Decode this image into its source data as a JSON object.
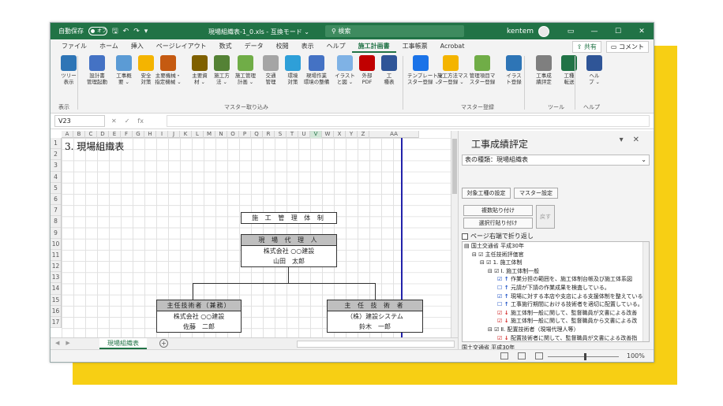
{
  "titlebar": {
    "autosave_label": "自動保存",
    "autosave_state": "オフ",
    "doc_title": "現場組織表-1_0.xls - 互換モード ⌄",
    "search_placeholder": "検索",
    "user": "kentem",
    "minimize": "—",
    "maximize": "☐",
    "close": "✕"
  },
  "menu": {
    "items": [
      "ファイル",
      "ホーム",
      "挿入",
      "ページレイアウト",
      "数式",
      "データ",
      "校閲",
      "表示",
      "ヘルプ",
      "施工計画書",
      "工事帳票",
      "Acrobat"
    ],
    "active": "施工計画書",
    "share": "共有",
    "comment": "コメント"
  },
  "ribbon": {
    "buttons": [
      {
        "label": "ツリー\n表示",
        "color": "#2e75b6"
      },
      {
        "label": "設計書\n管理起動",
        "color": "#4472c4"
      },
      {
        "label": "工事概\n要 ⌄",
        "color": "#5b9bd5"
      },
      {
        "label": "安全\n対策",
        "color": "#f4b400"
      },
      {
        "label": "主要機械・\n指定機械 ⌄",
        "color": "#c55a11"
      },
      {
        "label": "主要資\n材 ⌄",
        "color": "#7f6000"
      },
      {
        "label": "施工方\n法 ⌄",
        "color": "#548235"
      },
      {
        "label": "施工管理\n計画 ⌄",
        "color": "#70ad47"
      },
      {
        "label": "交通\n管理",
        "color": "#a5a5a5"
      },
      {
        "label": "環境\n対策",
        "color": "#2e9fd8"
      },
      {
        "label": "現場作業\n環境の整備",
        "color": "#4472c4"
      },
      {
        "label": "イラスト\nと図 ⌄",
        "color": "#7fb2e5"
      },
      {
        "label": "外部\nPDF",
        "color": "#c00000"
      },
      {
        "label": "工\n種表",
        "color": "#2f5597"
      },
      {
        "label": "テンプレートマ\nスター登録 ⌄",
        "color": "#1a73e8"
      },
      {
        "label": "施工方法マス\nター登録 ⌄",
        "color": "#f4b400"
      },
      {
        "label": "管理項目マ\nスター登録",
        "color": "#70ad47"
      },
      {
        "label": "イラス\nト登録",
        "color": "#2e75b6"
      },
      {
        "label": "工事成\n績評定",
        "color": "#7f7f7f"
      },
      {
        "label": "工種\n転送",
        "color": "#217346"
      },
      {
        "label": "ヘル\nプ ⌄",
        "color": "#2f5597"
      }
    ],
    "groups": [
      "表示",
      "マスター取り込み",
      "マスター登録",
      "ツール",
      "ヘルプ"
    ]
  },
  "formula": {
    "cell": "V23",
    "cancel": "✕",
    "enter": "✓",
    "fx": "fx"
  },
  "sheet": {
    "columns": [
      "A",
      "B",
      "C",
      "D",
      "E",
      "F",
      "G",
      "H",
      "I",
      "J",
      "K",
      "L",
      "M",
      "N",
      "O",
      "P",
      "Q",
      "R",
      "S",
      "T",
      "U",
      "V",
      "W",
      "X",
      "Y",
      "Z",
      "AA"
    ],
    "selected_column": "V",
    "rows": [
      "1",
      "2",
      "3",
      "4",
      "5",
      "6",
      "7",
      "8",
      "9",
      "10",
      "11",
      "12",
      "13",
      "14",
      "15",
      "16",
      "17"
    ],
    "title": "3. 現場組織表",
    "system_title": "施 工 管 理 体 制",
    "agent": {
      "role": "現 場 代 理 人",
      "company": "株式会社 ○○建設",
      "name": "山田　太郎"
    },
    "engineer_left": {
      "role": "主任技術者（兼務）",
      "company": "株式会社 ○○建設",
      "name": "佐藤　二郎"
    },
    "engineer_right": {
      "role": "主 任 技 術 者",
      "company": "（株）建設システム",
      "name": "鈴木　一郎"
    },
    "tab": "現場組織表"
  },
  "pane": {
    "title": "工事成績評定",
    "type_label": "表の種類：",
    "type_value": "現場組織表",
    "btn_target": "対象工種の設定",
    "btn_master": "マスター設定",
    "btn_paste_all": "複数貼り付け",
    "btn_paste_row": "選択行貼り付け",
    "btn_back": "戻す",
    "wrap_label": "ページ右端で折り返し",
    "tree": [
      "国土交通省 平成30年",
      "主任技術評価官",
      "1. 施工体制",
      "Ⅰ. 施工体制一般",
      "作業分担の範囲を、施工体制台帳及び施工体系図",
      "元請が下請の作業成果を検査している。",
      "現場に対する本店や支店による支援体制を整えている。",
      "工事施行期間における技術者を適切に配置している。",
      "施工体制一般に関して、監督職員が文書による改善",
      "施工体制一般に関して、監督職員から文書による改",
      "Ⅱ. 配置技術者（現場代理人等）",
      "配置技術者に関して、監督職員が文書による改善指"
    ],
    "note": "国土交通省 平成30年"
  },
  "status": {
    "zoom": "100%"
  }
}
